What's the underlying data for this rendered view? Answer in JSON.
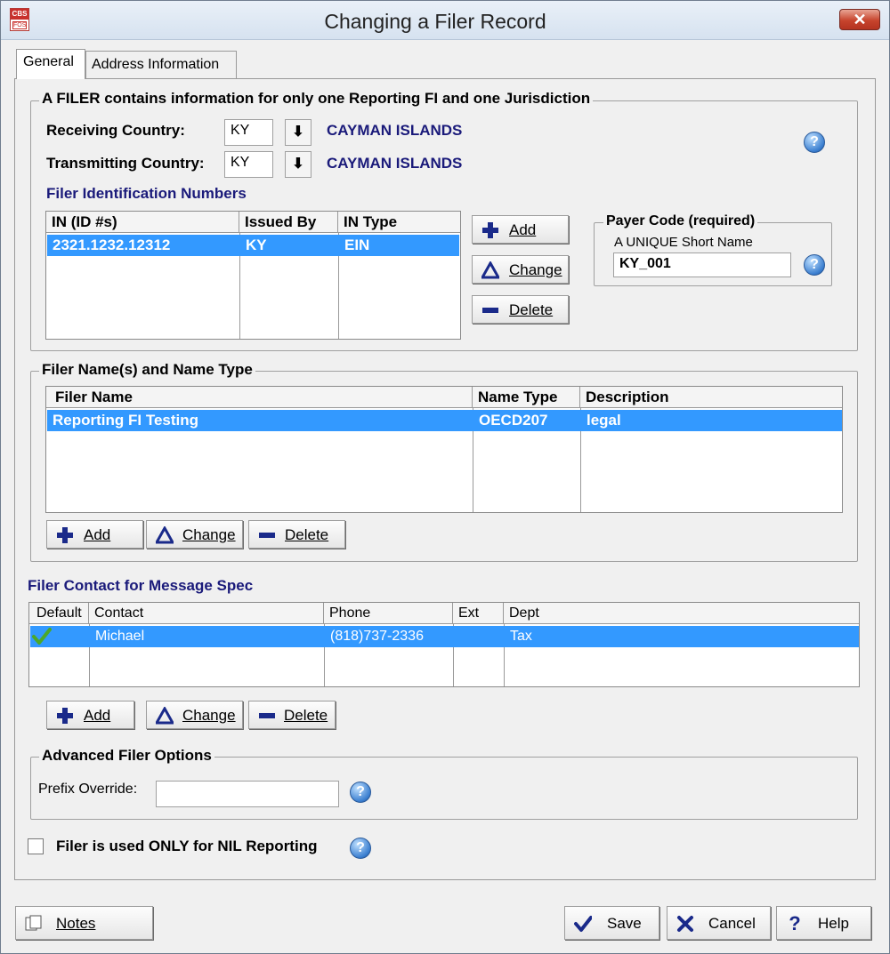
{
  "window": {
    "title": "Changing a Filer Record",
    "app_icon_top": "CBS",
    "app_icon_bottom": "FOS",
    "close_glyph": "✕"
  },
  "tabs": [
    {
      "label": "General"
    },
    {
      "label": "Address Information"
    }
  ],
  "filer_group": {
    "legend": "A FILER contains information for only one Reporting FI and one Jurisdiction",
    "receiving_label": "Receiving Country:",
    "receiving_value": "KY",
    "receiving_name": "CAYMAN ISLANDS",
    "transmitting_label": "Transmitting Country:",
    "transmitting_value": "KY",
    "transmitting_name": "CAYMAN ISLANDS",
    "dropdown_glyph": "⬇",
    "id_numbers_heading": "Filer Identification Numbers",
    "id_table": {
      "columns": [
        "IN (ID #s)",
        "Issued By",
        "IN Type"
      ],
      "rows": [
        {
          "in": "2321.1232.12312",
          "issued_by": "KY",
          "in_type": "EIN"
        }
      ]
    },
    "buttons": {
      "add": "Add",
      "change": "Change",
      "delete": "Delete"
    },
    "payer": {
      "legend": "Payer Code (required)",
      "sublabel": "A UNIQUE Short Name",
      "value": "KY_001"
    }
  },
  "names_group": {
    "legend": "Filer Name(s) and Name Type",
    "table": {
      "columns": [
        "Filer Name",
        "Name Type",
        "Description"
      ],
      "rows": [
        {
          "name": "Reporting FI Testing",
          "name_type": "OECD207",
          "description": "legal"
        }
      ]
    },
    "buttons": {
      "add": "Add",
      "change": "Change",
      "delete": "Delete"
    }
  },
  "contact": {
    "heading": "Filer Contact for Message Spec",
    "table": {
      "columns": [
        "Default",
        "Contact",
        "Phone",
        "Ext",
        "Dept"
      ],
      "rows": [
        {
          "default": true,
          "contact": "Michael",
          "phone": "(818)737-2336",
          "ext": "",
          "dept": "Tax"
        }
      ]
    },
    "buttons": {
      "add": "Add",
      "change": "Change",
      "delete": "Delete"
    }
  },
  "advanced": {
    "legend": "Advanced Filer Options",
    "prefix_label": "Prefix Override:",
    "prefix_value": ""
  },
  "nil": {
    "label": "Filer is used ONLY for NIL Reporting",
    "checked": false
  },
  "help_glyph": "?",
  "footer": {
    "notes": "Notes",
    "save": "Save",
    "cancel": "Cancel",
    "help": "Help"
  },
  "colors": {
    "selection": "#3399ff",
    "heading_blue": "#1a1a7a",
    "title_close": "#c7442d"
  }
}
